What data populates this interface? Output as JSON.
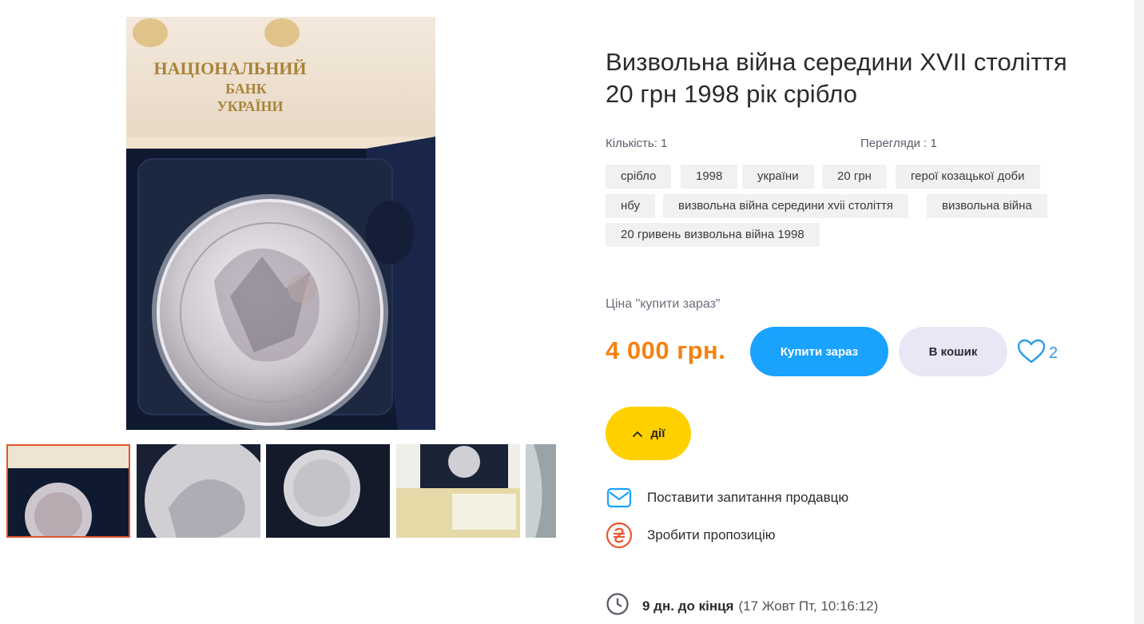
{
  "product": {
    "title_line1": "Визвольна війна середини XVII століття",
    "title_line2": "20 грн 1998 рік срібло",
    "quantity": "Кількість: 1",
    "views": "Перегляди : 1"
  },
  "photo": {
    "box_text_line1": "НАЦІОНАЛЬНИЙ",
    "box_text_line2": "БАНК",
    "box_text_line3": "УКРАЇНИ",
    "thumb_count": 5,
    "active_thumb": 1
  },
  "tags": [
    "срібло",
    "1998",
    "україни",
    "20 грн",
    "герої козацької доби",
    "нбу",
    "визвольна війна середини xvii століття",
    "визвольна війна",
    "20 гривень визвольна війна 1998"
  ],
  "pricing": {
    "label": "Ціна \"купити зараз\"",
    "price": "4 000 грн.",
    "buy_now": "Купити зараз",
    "add_to_cart": "В кошик",
    "favorites_count": "2"
  },
  "actions": {
    "label": "дії",
    "ask_seller": "Поставити запитання продавцю",
    "make_offer": "Зробити пропозицію"
  },
  "ending": {
    "remaining": "9 дн. до кінця",
    "date": "(17 Жовт Пт, 10:16:12)"
  },
  "colors": {
    "accent_blue": "#1aa2ff",
    "price_orange": "#f5810f",
    "actions_yellow": "#ffd000",
    "offer_icon": "#e8552a",
    "active_thumb_border": "#e0552c"
  },
  "icons": {
    "favorite": "heart-icon",
    "ask": "mail-icon",
    "offer": "hryvnia-icon",
    "timer": "clock-icon",
    "actions": "chevron-up-icon"
  }
}
